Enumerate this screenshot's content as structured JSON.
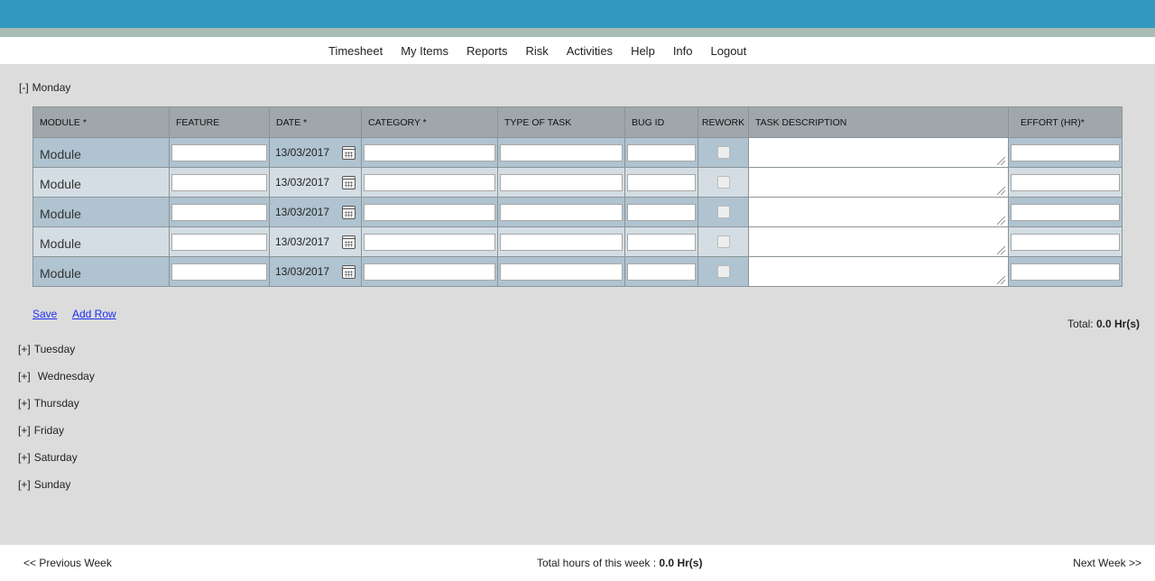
{
  "nav": [
    "Timesheet",
    "My Items",
    "Reports",
    "Risk",
    "Activities",
    "Help",
    "Info",
    "Logout"
  ],
  "monday": {
    "toggle": "[-]",
    "label": "Monday"
  },
  "table": {
    "headers": [
      "MODULE *",
      "FEATURE",
      "DATE *",
      "CATEGORY *",
      "TYPE OF TASK",
      "BUG ID",
      "REWORK",
      "TASK DESCRIPTION",
      "EFFORT (HR)*"
    ],
    "rows": [
      {
        "module": "Module",
        "date": "13/03/2017"
      },
      {
        "module": "Module",
        "date": "13/03/2017"
      },
      {
        "module": "Module",
        "date": "13/03/2017"
      },
      {
        "module": "Module",
        "date": "13/03/2017"
      },
      {
        "module": "Module",
        "date": "13/03/2017"
      }
    ]
  },
  "actions": {
    "save": "Save",
    "add_row": "Add Row"
  },
  "day_total": {
    "label": "Total:",
    "value": "0.0 Hr(s)"
  },
  "collapsed_days": [
    {
      "toggle": "[+]",
      "label": "Tuesday"
    },
    {
      "toggle": "[+]",
      "label": "Wednesday"
    },
    {
      "toggle": "[+]",
      "label": "Thursday"
    },
    {
      "toggle": "[+]",
      "label": "Friday"
    },
    {
      "toggle": "[+]",
      "label": "Saturday"
    },
    {
      "toggle": "[+]",
      "label": "Sunday"
    }
  ],
  "footer": {
    "prev": "<< Previous Week",
    "week_total_label": "Total hours of this week :",
    "week_total_value": "0.0 Hr(s)",
    "next": "Next Week >>"
  },
  "colors": {
    "topbar": "#3299c1",
    "stripe": "#a8bdb4",
    "row_odd": "#afc3d0",
    "row_even": "#d3dde3",
    "link": "#1a2ff0"
  }
}
